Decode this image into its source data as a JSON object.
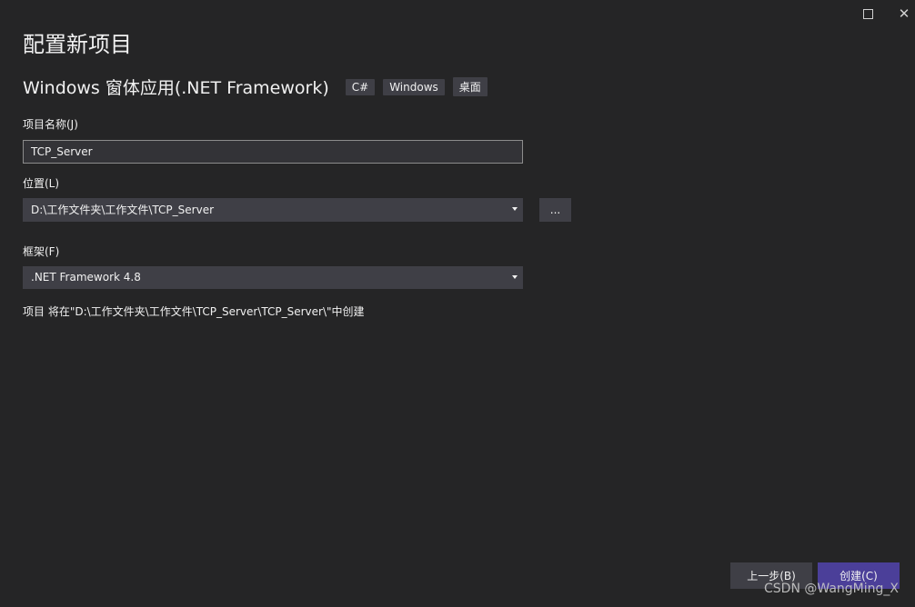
{
  "window": {
    "maximize_icon": "maximize-icon",
    "close_icon": "close-icon",
    "close_glyph": "✕"
  },
  "page": {
    "title": "配置新项目",
    "subtitle": "Windows 窗体应用(.NET Framework)",
    "tags": [
      "C#",
      "Windows",
      "桌面"
    ]
  },
  "form": {
    "project_name_label": "项目名称(J)",
    "project_name_value": "TCP_Server",
    "location_label": "位置(L)",
    "location_value": "D:\\工作文件夹\\工作文件\\TCP_Server",
    "browse_label": "...",
    "framework_label": "框架(F)",
    "framework_value": ".NET Framework 4.8",
    "path_note": "项目 将在\"D:\\工作文件夹\\工作文件\\TCP_Server\\TCP_Server\\\"中创建"
  },
  "footer": {
    "back_label": "上一步(B)",
    "create_label": "创建(C)",
    "watermark": "CSDN @WangMing_X"
  },
  "colors": {
    "background": "#252526",
    "control": "#3f3f46",
    "accent": "#4b3f99",
    "text": "#f1f1f1"
  }
}
